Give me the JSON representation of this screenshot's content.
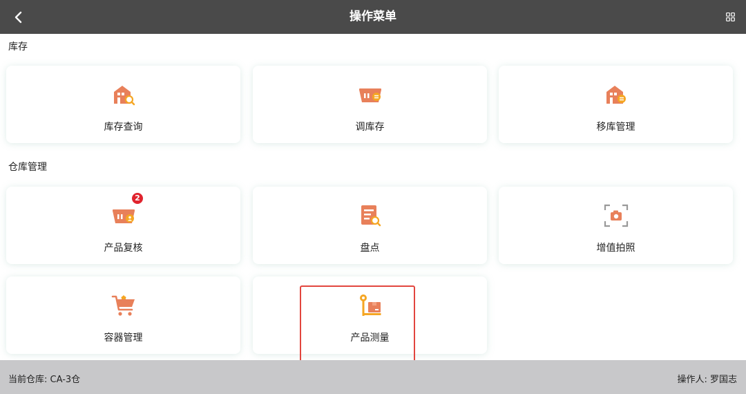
{
  "header": {
    "title": "操作菜单",
    "back_icon": "chevron-left-icon",
    "grid_icon": "grid-icon"
  },
  "sections": [
    {
      "title": "库存",
      "tiles": [
        {
          "label": "库存查询",
          "icon": "warehouse-search-icon"
        },
        {
          "label": "调库存",
          "icon": "basket-transfer-icon"
        },
        {
          "label": "移库管理",
          "icon": "warehouse-transfer-icon"
        }
      ]
    },
    {
      "title": "仓库管理",
      "tiles": [
        {
          "label": "产品复核",
          "icon": "basket-user-icon",
          "badge": "2"
        },
        {
          "label": "盘点",
          "icon": "document-search-icon"
        },
        {
          "label": "增值拍照",
          "icon": "camera-scan-icon"
        },
        {
          "label": "容器管理",
          "icon": "shopping-cart-icon"
        },
        {
          "label": "产品测量",
          "icon": "package-measure-icon"
        }
      ]
    }
  ],
  "footer": {
    "warehouse": "当前仓库: CA-3仓",
    "operator": "操作人: 罗国志"
  },
  "colors": {
    "header_bg": "#4a4a4a",
    "icon_primary": "#e8805a",
    "icon_accent": "#f5a623",
    "badge": "#e0242e",
    "highlight": "#e2453e",
    "footer_bg": "#c8c8ca"
  }
}
